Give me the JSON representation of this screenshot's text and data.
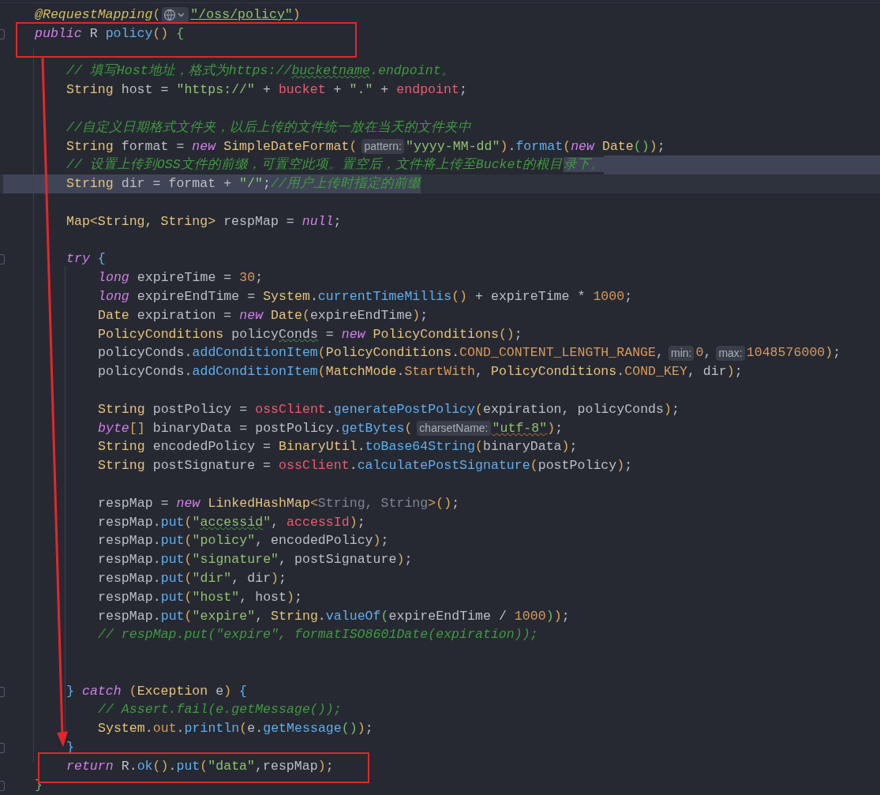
{
  "lines": [
    {
      "kind": "top",
      "fold": false,
      "current": false,
      "tokens": [
        {
          "kind": "annot",
          "text": "@RequestMapping"
        },
        {
          "kind": "paren",
          "text": "("
        },
        {
          "kind": "globe"
        },
        {
          "kind": "str",
          "link": true,
          "text": "\"/oss/policy\""
        },
        {
          "kind": "paren",
          "text": ")"
        }
      ]
    },
    {
      "kind": "top",
      "fold": true,
      "current": false,
      "boxed": true,
      "tokens": [
        {
          "kind": "kw",
          "text": "public"
        },
        {
          "kind": "plain",
          "text": " R "
        },
        {
          "kind": "method",
          "text": "policy"
        },
        {
          "kind": "paren",
          "text": "()"
        },
        {
          "kind": "brace",
          "text": " {"
        }
      ]
    },
    {
      "kind": "blank",
      "fold": false,
      "current": false,
      "boxed": true
    },
    {
      "kind": "body",
      "fold": false,
      "current": false,
      "arrow_start": true,
      "tokens": [
        {
          "kind": "comment",
          "text": "// 填写Host地址，格式为https://"
        },
        {
          "kind": "comment",
          "typo": true,
          "text": "bucketname"
        },
        {
          "kind": "comment",
          "text": ".endpoint。"
        }
      ]
    },
    {
      "kind": "body",
      "fold": false,
      "current": false,
      "tokens": [
        {
          "kind": "type",
          "text": "String"
        },
        {
          "kind": "plain",
          "text": " host = "
        },
        {
          "kind": "str",
          "text": "\"https://\""
        },
        {
          "kind": "plain",
          "text": " + "
        },
        {
          "kind": "field",
          "text": "bucket"
        },
        {
          "kind": "plain",
          "text": " + "
        },
        {
          "kind": "str",
          "text": "\".\""
        },
        {
          "kind": "plain",
          "text": " + "
        },
        {
          "kind": "field",
          "text": "endpoint"
        },
        {
          "kind": "plain",
          "text": ";"
        }
      ]
    },
    {
      "kind": "blank",
      "fold": false,
      "current": false
    },
    {
      "kind": "body",
      "fold": false,
      "current": false,
      "tokens": [
        {
          "kind": "comment",
          "text": "//自定义日期格式文件夹，以后上传的文件统一放在当天的文件夹中"
        }
      ]
    },
    {
      "kind": "body",
      "fold": false,
      "current": false,
      "tokens": [
        {
          "kind": "type",
          "text": "String"
        },
        {
          "kind": "plain",
          "text": " format = "
        },
        {
          "kind": "kw",
          "text": "new"
        },
        {
          "kind": "type",
          "text": " SimpleDateFormat"
        },
        {
          "kind": "paren",
          "text": "("
        },
        {
          "kind": "hint",
          "text": "pattern:"
        },
        {
          "kind": "str",
          "text": "\"yyyy-MM-dd\""
        },
        {
          "kind": "paren",
          "text": ")"
        },
        {
          "kind": "plain",
          "text": "."
        },
        {
          "kind": "method",
          "text": "format"
        },
        {
          "kind": "paren",
          "text": "("
        },
        {
          "kind": "kw",
          "text": "new"
        },
        {
          "kind": "type",
          "text": " Date"
        },
        {
          "kind": "paren2",
          "text": "()"
        },
        {
          "kind": "paren",
          "text": ")"
        },
        {
          "kind": "plain",
          "text": ";"
        }
      ]
    },
    {
      "kind": "body",
      "fold": false,
      "current": false,
      "eol_selected": true,
      "tokens": [
        {
          "kind": "comment",
          "text": "// 设置上传到OSS文件的前缀，可置空此项。置空后，文件将上传至Bucket的根目"
        },
        {
          "kind": "comment",
          "selected": true,
          "text": "录下。"
        }
      ]
    },
    {
      "kind": "body",
      "fold": false,
      "current": true,
      "tokens": [
        {
          "kind": "type",
          "selected": true,
          "text": "String"
        },
        {
          "kind": "plain",
          "selected": true,
          "text": " dir = format + "
        },
        {
          "kind": "str",
          "selected": true,
          "text": "\"/\""
        },
        {
          "kind": "plain",
          "selected": true,
          "text": ";"
        },
        {
          "kind": "comment",
          "selected": true,
          "text": "//用户上传时指定的前缀"
        }
      ]
    },
    {
      "kind": "blank",
      "fold": false,
      "current": false
    },
    {
      "kind": "body",
      "fold": false,
      "current": false,
      "tokens": [
        {
          "kind": "type",
          "text": "Map<String, String>"
        },
        {
          "kind": "plain",
          "text": " respMap = "
        },
        {
          "kind": "kw",
          "text": "null"
        },
        {
          "kind": "plain",
          "text": ";"
        }
      ]
    },
    {
      "kind": "blank",
      "fold": false,
      "current": false
    },
    {
      "kind": "body",
      "fold": true,
      "current": false,
      "tokens": [
        {
          "kind": "kw",
          "text": "try"
        },
        {
          "kind": "block",
          "text": " {"
        }
      ]
    },
    {
      "kind": "inner",
      "fold": false,
      "current": false,
      "tokens": [
        {
          "kind": "kw",
          "text": "long"
        },
        {
          "kind": "plain",
          "text": " expireTime = "
        },
        {
          "kind": "num",
          "text": "30"
        },
        {
          "kind": "plain",
          "text": ";"
        }
      ]
    },
    {
      "kind": "inner",
      "fold": false,
      "current": false,
      "tokens": [
        {
          "kind": "kw",
          "text": "long"
        },
        {
          "kind": "plain",
          "text": " expireEndTime = "
        },
        {
          "kind": "type",
          "text": "System"
        },
        {
          "kind": "plain",
          "text": "."
        },
        {
          "kind": "method",
          "text": "currentTimeMillis"
        },
        {
          "kind": "paren",
          "text": "()"
        },
        {
          "kind": "plain",
          "text": " + expireTime * "
        },
        {
          "kind": "num",
          "text": "1000"
        },
        {
          "kind": "plain",
          "text": ";"
        }
      ]
    },
    {
      "kind": "inner",
      "fold": false,
      "current": false,
      "tokens": [
        {
          "kind": "type",
          "text": "Date"
        },
        {
          "kind": "plain",
          "text": " expiration = "
        },
        {
          "kind": "kw",
          "text": "new"
        },
        {
          "kind": "type",
          "text": " Date"
        },
        {
          "kind": "paren",
          "text": "("
        },
        {
          "kind": "plain",
          "text": "expireEndTime"
        },
        {
          "kind": "paren",
          "text": ")"
        },
        {
          "kind": "plain",
          "text": ";"
        }
      ]
    },
    {
      "kind": "inner",
      "fold": false,
      "current": false,
      "tokens": [
        {
          "kind": "type",
          "text": "PolicyConditions"
        },
        {
          "kind": "plain",
          "text": " policy"
        },
        {
          "kind": "plain",
          "typo": true,
          "text": "Conds"
        },
        {
          "kind": "plain",
          "text": " = "
        },
        {
          "kind": "kw",
          "text": "new"
        },
        {
          "kind": "type",
          "text": " PolicyConditions"
        },
        {
          "kind": "paren",
          "text": "()"
        },
        {
          "kind": "plain",
          "text": ";"
        }
      ]
    },
    {
      "kind": "inner",
      "fold": false,
      "current": false,
      "tokens": [
        {
          "kind": "plain",
          "text": "policyConds."
        },
        {
          "kind": "method",
          "text": "addConditionItem"
        },
        {
          "kind": "paren",
          "text": "("
        },
        {
          "kind": "type",
          "text": "PolicyConditions"
        },
        {
          "kind": "plain",
          "text": "."
        },
        {
          "kind": "const",
          "text": "COND_CONTENT_LENGTH_RANGE"
        },
        {
          "kind": "plain",
          "text": ","
        },
        {
          "kind": "hint",
          "text": "min:"
        },
        {
          "kind": "num",
          "text": "0"
        },
        {
          "kind": "plain",
          "text": ","
        },
        {
          "kind": "hint",
          "text": "max:"
        },
        {
          "kind": "num",
          "text": "1048576000"
        },
        {
          "kind": "paren",
          "text": ")"
        },
        {
          "kind": "plain",
          "text": ";"
        }
      ]
    },
    {
      "kind": "inner",
      "fold": false,
      "current": false,
      "tokens": [
        {
          "kind": "plain",
          "text": "policyConds."
        },
        {
          "kind": "method",
          "text": "addConditionItem"
        },
        {
          "kind": "paren",
          "text": "("
        },
        {
          "kind": "type",
          "text": "MatchMode"
        },
        {
          "kind": "plain",
          "text": "."
        },
        {
          "kind": "const",
          "text": "StartWith"
        },
        {
          "kind": "plain",
          "text": ", "
        },
        {
          "kind": "type",
          "text": "PolicyConditions"
        },
        {
          "kind": "plain",
          "text": "."
        },
        {
          "kind": "const",
          "text": "COND_KEY"
        },
        {
          "kind": "plain",
          "text": ", dir"
        },
        {
          "kind": "paren",
          "text": ")"
        },
        {
          "kind": "plain",
          "text": ";"
        }
      ]
    },
    {
      "kind": "blank",
      "fold": false,
      "current": false
    },
    {
      "kind": "inner",
      "fold": false,
      "current": false,
      "tokens": [
        {
          "kind": "type",
          "text": "String"
        },
        {
          "kind": "plain",
          "text": " postPolicy = "
        },
        {
          "kind": "field",
          "text": "ossClient"
        },
        {
          "kind": "plain",
          "text": "."
        },
        {
          "kind": "method",
          "text": "generatePostPolicy"
        },
        {
          "kind": "paren",
          "text": "("
        },
        {
          "kind": "plain",
          "text": "expiration, policyConds"
        },
        {
          "kind": "paren",
          "text": ")"
        },
        {
          "kind": "plain",
          "text": ";"
        }
      ]
    },
    {
      "kind": "inner",
      "fold": false,
      "current": false,
      "tokens": [
        {
          "kind": "kw",
          "text": "byte"
        },
        {
          "kind": "paren",
          "text": "[]"
        },
        {
          "kind": "plain",
          "text": " binaryData = postPolicy."
        },
        {
          "kind": "method",
          "text": "getBytes"
        },
        {
          "kind": "paren",
          "text": "("
        },
        {
          "kind": "hint",
          "text": "charsetName:"
        },
        {
          "kind": "str",
          "warning": true,
          "text": "\"utf-8\""
        },
        {
          "kind": "paren",
          "text": ")"
        },
        {
          "kind": "plain",
          "text": ";"
        }
      ]
    },
    {
      "kind": "inner",
      "fold": false,
      "current": false,
      "tokens": [
        {
          "kind": "type",
          "text": "String"
        },
        {
          "kind": "plain",
          "text": " encodedPolicy = "
        },
        {
          "kind": "type",
          "text": "BinaryUtil"
        },
        {
          "kind": "plain",
          "text": "."
        },
        {
          "kind": "method",
          "text": "toBase64String"
        },
        {
          "kind": "paren",
          "text": "("
        },
        {
          "kind": "plain",
          "text": "binaryData"
        },
        {
          "kind": "paren",
          "text": ")"
        },
        {
          "kind": "plain",
          "text": ";"
        }
      ]
    },
    {
      "kind": "inner",
      "fold": false,
      "current": false,
      "tokens": [
        {
          "kind": "type",
          "text": "String"
        },
        {
          "kind": "plain",
          "text": " postSignature = "
        },
        {
          "kind": "field",
          "text": "ossClient"
        },
        {
          "kind": "plain",
          "text": "."
        },
        {
          "kind": "method",
          "text": "calculatePostSignature"
        },
        {
          "kind": "paren",
          "text": "("
        },
        {
          "kind": "plain",
          "text": "postPolicy"
        },
        {
          "kind": "paren",
          "text": ")"
        },
        {
          "kind": "plain",
          "text": ";"
        }
      ]
    },
    {
      "kind": "blank",
      "fold": false,
      "current": false
    },
    {
      "kind": "inner",
      "fold": false,
      "current": false,
      "tokens": [
        {
          "kind": "plain",
          "text": "respMap = "
        },
        {
          "kind": "kw",
          "text": "new"
        },
        {
          "kind": "type",
          "text": " LinkedHashMap"
        },
        {
          "kind": "paren",
          "text": "<"
        },
        {
          "kind": "muted",
          "text": "String, String"
        },
        {
          "kind": "paren",
          "text": ">()"
        },
        {
          "kind": "plain",
          "text": ";"
        }
      ]
    },
    {
      "kind": "inner",
      "fold": false,
      "current": false,
      "tokens": [
        {
          "kind": "plain",
          "text": "respMap."
        },
        {
          "kind": "method",
          "text": "put"
        },
        {
          "kind": "paren",
          "text": "("
        },
        {
          "kind": "str",
          "text": "\""
        },
        {
          "kind": "str",
          "typo": true,
          "text": "accessid"
        },
        {
          "kind": "str",
          "text": "\""
        },
        {
          "kind": "plain",
          "text": ", "
        },
        {
          "kind": "field",
          "text": "accessId"
        },
        {
          "kind": "paren",
          "text": ")"
        },
        {
          "kind": "plain",
          "text": ";"
        }
      ]
    },
    {
      "kind": "inner",
      "fold": false,
      "current": false,
      "tokens": [
        {
          "kind": "plain",
          "text": "respMap."
        },
        {
          "kind": "method",
          "text": "put"
        },
        {
          "kind": "paren",
          "text": "("
        },
        {
          "kind": "str",
          "text": "\"policy\""
        },
        {
          "kind": "plain",
          "text": ", encodedPolicy"
        },
        {
          "kind": "paren",
          "text": ")"
        },
        {
          "kind": "plain",
          "text": ";"
        }
      ]
    },
    {
      "kind": "inner",
      "fold": false,
      "current": false,
      "tokens": [
        {
          "kind": "plain",
          "text": "respMap."
        },
        {
          "kind": "method",
          "text": "put"
        },
        {
          "kind": "paren",
          "text": "("
        },
        {
          "kind": "str",
          "text": "\"signature\""
        },
        {
          "kind": "plain",
          "text": ", postSignature"
        },
        {
          "kind": "paren",
          "text": ")"
        },
        {
          "kind": "plain",
          "text": ";"
        }
      ]
    },
    {
      "kind": "inner",
      "fold": false,
      "current": false,
      "tokens": [
        {
          "kind": "plain",
          "text": "respMap."
        },
        {
          "kind": "method",
          "text": "put"
        },
        {
          "kind": "paren",
          "text": "("
        },
        {
          "kind": "str",
          "text": "\"dir\""
        },
        {
          "kind": "plain",
          "text": ", dir"
        },
        {
          "kind": "paren",
          "text": ")"
        },
        {
          "kind": "plain",
          "text": ";"
        }
      ]
    },
    {
      "kind": "inner",
      "fold": false,
      "current": false,
      "tokens": [
        {
          "kind": "plain",
          "text": "respMap."
        },
        {
          "kind": "method",
          "text": "put"
        },
        {
          "kind": "paren",
          "text": "("
        },
        {
          "kind": "str",
          "text": "\"host\""
        },
        {
          "kind": "plain",
          "text": ", host"
        },
        {
          "kind": "paren",
          "text": ")"
        },
        {
          "kind": "plain",
          "text": ";"
        }
      ]
    },
    {
      "kind": "inner",
      "fold": false,
      "current": false,
      "tokens": [
        {
          "kind": "plain",
          "text": "respMap."
        },
        {
          "kind": "method",
          "text": "put"
        },
        {
          "kind": "paren",
          "text": "("
        },
        {
          "kind": "str",
          "text": "\"expire\""
        },
        {
          "kind": "plain",
          "text": ", "
        },
        {
          "kind": "type",
          "text": "String"
        },
        {
          "kind": "plain",
          "text": "."
        },
        {
          "kind": "method",
          "text": "valueOf"
        },
        {
          "kind": "paren2",
          "text": "("
        },
        {
          "kind": "plain",
          "text": "expireEndTime / "
        },
        {
          "kind": "num",
          "text": "1000"
        },
        {
          "kind": "paren2",
          "text": ")"
        },
        {
          "kind": "paren",
          "text": ")"
        },
        {
          "kind": "plain",
          "text": ";"
        }
      ]
    },
    {
      "kind": "inner",
      "fold": false,
      "current": false,
      "tokens": [
        {
          "kind": "comment",
          "text": "// respMap.put(\"expire\", formatISO8601Date(expiration));"
        }
      ]
    },
    {
      "kind": "blank",
      "fold": false,
      "current": false
    },
    {
      "kind": "blank",
      "fold": false,
      "current": false
    },
    {
      "kind": "body",
      "fold": true,
      "current": false,
      "tokens": [
        {
          "kind": "block",
          "text": "}"
        },
        {
          "kind": "kw",
          "text": " catch"
        },
        {
          "kind": "paren",
          "text": " ("
        },
        {
          "kind": "type",
          "text": "Exception"
        },
        {
          "kind": "plain",
          "text": " e"
        },
        {
          "kind": "paren",
          "text": ")"
        },
        {
          "kind": "block",
          "text": " {"
        }
      ]
    },
    {
      "kind": "inner",
      "fold": false,
      "current": false,
      "tokens": [
        {
          "kind": "comment",
          "text": "// Assert.fail(e.getMessage());"
        }
      ]
    },
    {
      "kind": "inner",
      "fold": false,
      "current": false,
      "tokens": [
        {
          "kind": "type",
          "text": "System"
        },
        {
          "kind": "plain",
          "text": "."
        },
        {
          "kind": "const",
          "text": "out"
        },
        {
          "kind": "plain",
          "text": "."
        },
        {
          "kind": "method",
          "text": "println"
        },
        {
          "kind": "paren",
          "text": "("
        },
        {
          "kind": "plain",
          "text": "e."
        },
        {
          "kind": "method",
          "text": "getMessage"
        },
        {
          "kind": "paren2",
          "text": "()"
        },
        {
          "kind": "paren",
          "text": ")"
        },
        {
          "kind": "plain",
          "text": ";"
        }
      ]
    },
    {
      "kind": "body",
      "fold": true,
      "current": false,
      "arrow_end": true,
      "tokens": [
        {
          "kind": "block",
          "text": "}"
        }
      ]
    },
    {
      "kind": "body",
      "fold": false,
      "current": false,
      "boxed": true,
      "tokens": [
        {
          "kind": "kw",
          "text": "return"
        },
        {
          "kind": "plain",
          "text": " R."
        },
        {
          "kind": "method",
          "text": "ok"
        },
        {
          "kind": "paren",
          "text": "()"
        },
        {
          "kind": "plain",
          "text": "."
        },
        {
          "kind": "method",
          "text": "put"
        },
        {
          "kind": "paren",
          "text": "("
        },
        {
          "kind": "str",
          "text": "\"data\""
        },
        {
          "kind": "plain",
          "text": ",respMap"
        },
        {
          "kind": "paren",
          "text": ")"
        },
        {
          "kind": "plain",
          "text": ";"
        }
      ]
    },
    {
      "kind": "top",
      "fold": true,
      "current": false,
      "tokens": [
        {
          "kind": "brace",
          "text": "}"
        }
      ]
    }
  ]
}
